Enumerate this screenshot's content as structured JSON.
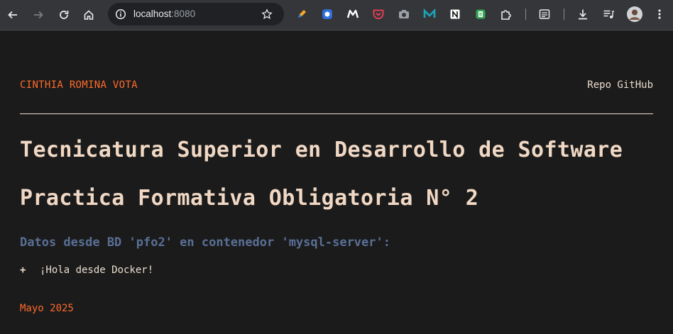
{
  "browser": {
    "url_host": "localhost",
    "url_port": ":8080",
    "extensions": [
      "pen-icon",
      "extension-shield-icon",
      "extension-m-icon",
      "pocket-icon",
      "camera-icon",
      "extension-m2-icon",
      "notion-icon",
      "extension-doc-icon",
      "puzzle-icon"
    ],
    "toolbar_icons": [
      "reading-list-icon",
      "download-icon",
      "media-queue-icon",
      "avatar"
    ]
  },
  "page": {
    "author": "CINTHIA ROMINA VOTA",
    "repo_link": "Repo GitHub",
    "title_line1": "Tecnicatura Superior en Desarrollo de Software",
    "title_line2": "Practica Formativa Obligatoria N° 2",
    "data_heading": "Datos desde BD 'pfo2' en contenedor 'mysql-server':",
    "items": [
      {
        "bullet": "+",
        "text": "¡Hola desde Docker!"
      }
    ],
    "date": "Mayo 2025"
  },
  "colors": {
    "accent_orange": "#ff6b2b",
    "heading": "#f0d8c4",
    "subtitle_blue": "#5a6f96",
    "background": "#1b1b1b"
  }
}
